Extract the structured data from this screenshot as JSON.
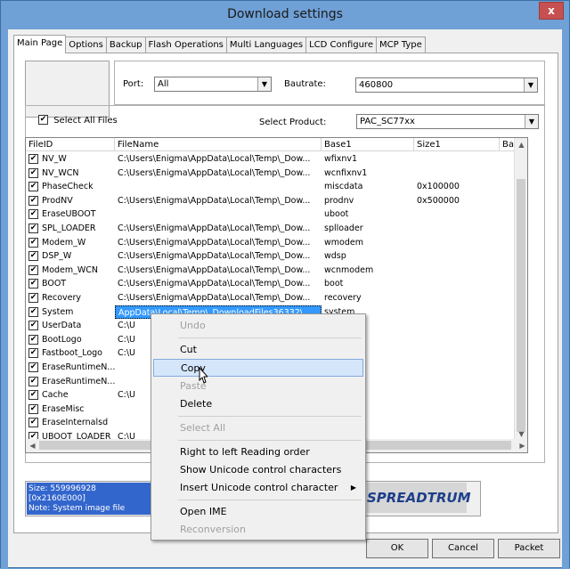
{
  "window": {
    "title": "Download settings",
    "close_label": "x"
  },
  "tabs": [
    "Main Page",
    "Options",
    "Backup",
    "Flash Operations",
    "Multi Languages",
    "LCD Configure",
    "MCP Type"
  ],
  "port": {
    "label": "Port:",
    "value": "All"
  },
  "baudrate": {
    "label": "Bautrate:",
    "value": "460800"
  },
  "select_all": {
    "label": "Select All Files",
    "checked": true
  },
  "product": {
    "label": "Select Product:",
    "value": "PAC_SC77xx"
  },
  "table": {
    "columns": [
      "FileID",
      "FileName",
      "Base1",
      "Size1",
      "Ba"
    ],
    "rows": [
      {
        "id": "NV_W",
        "file": "C:\\Users\\Enigma\\AppData\\Local\\Temp\\_Dow...",
        "base": "wfixnv1",
        "size": ""
      },
      {
        "id": "NV_WCN",
        "file": "C:\\Users\\Enigma\\AppData\\Local\\Temp\\_Dow...",
        "base": "wcnfixnv1",
        "size": ""
      },
      {
        "id": "PhaseCheck",
        "file": "",
        "base": "miscdata",
        "size": "0x100000"
      },
      {
        "id": "ProdNV",
        "file": "C:\\Users\\Enigma\\AppData\\Local\\Temp\\_Dow...",
        "base": "prodnv",
        "size": "0x500000"
      },
      {
        "id": "EraseUBOOT",
        "file": "",
        "base": "uboot",
        "size": ""
      },
      {
        "id": "SPL_LOADER",
        "file": "C:\\Users\\Enigma\\AppData\\Local\\Temp\\_Dow...",
        "base": "splloader",
        "size": ""
      },
      {
        "id": "Modem_W",
        "file": "C:\\Users\\Enigma\\AppData\\Local\\Temp\\_Dow...",
        "base": "wmodem",
        "size": ""
      },
      {
        "id": "DSP_W",
        "file": "C:\\Users\\Enigma\\AppData\\Local\\Temp\\_Dow...",
        "base": "wdsp",
        "size": ""
      },
      {
        "id": "Modem_WCN",
        "file": "C:\\Users\\Enigma\\AppData\\Local\\Temp\\_Dow...",
        "base": "wcnmodem",
        "size": ""
      },
      {
        "id": "BOOT",
        "file": "C:\\Users\\Enigma\\AppData\\Local\\Temp\\_Dow...",
        "base": "boot",
        "size": ""
      },
      {
        "id": "Recovery",
        "file": "C:\\Users\\Enigma\\AppData\\Local\\Temp\\_Dow...",
        "base": "recovery",
        "size": ""
      },
      {
        "id": "System",
        "file": "AppData\\Local\\Temp\\_DownloadFiles36332\\",
        "base": "system",
        "size": ""
      },
      {
        "id": "UserData",
        "file": "C:\\U",
        "base": "",
        "size": ""
      },
      {
        "id": "BootLogo",
        "file": "C:\\U",
        "base": "",
        "size": ""
      },
      {
        "id": "Fastboot_Logo",
        "file": "C:\\U",
        "base": "",
        "size": ""
      },
      {
        "id": "EraseRuntimeN...",
        "file": "",
        "base": "",
        "size": ""
      },
      {
        "id": "EraseRuntimeN...",
        "file": "",
        "base": "",
        "size": ""
      },
      {
        "id": "Cache",
        "file": "C:\\U",
        "base": "",
        "size": ""
      },
      {
        "id": "EraseMisc",
        "file": "",
        "base": "",
        "size": ""
      },
      {
        "id": "EraseInternalsd",
        "file": "",
        "base": "",
        "size": ""
      },
      {
        "id": "UBOOT_LOADER",
        "file": "C:\\U",
        "base": "",
        "size": ""
      }
    ]
  },
  "status": {
    "line1": "Size: 559996928 [0x2160E000]",
    "line2": "Note: System image file"
  },
  "brand": "SPREADTRUM",
  "buttons": {
    "ok": "OK",
    "cancel": "Cancel",
    "packet": "Packet"
  },
  "context_menu": {
    "undo": "Undo",
    "cut": "Cut",
    "copy": "Copy",
    "paste": "Paste",
    "delete": "Delete",
    "select_all": "Select All",
    "rtl": "Right to left Reading order",
    "show_unicode": "Show Unicode control characters",
    "insert_unicode": "Insert Unicode control character",
    "open_ime": "Open IME",
    "reconversion": "Reconversion"
  }
}
